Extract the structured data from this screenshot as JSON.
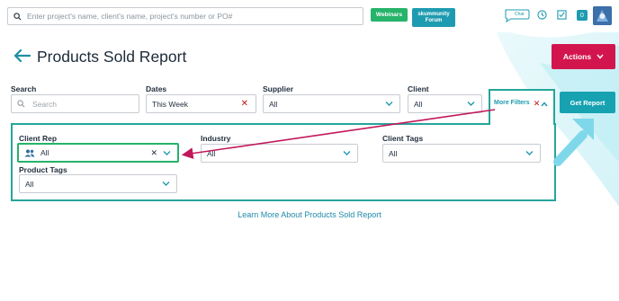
{
  "topbar": {
    "search_placeholder": "Enter project's name, client's name, project's number or PO#",
    "webinars_label": "Webinars",
    "forum_line1": "skummunity",
    "forum_line2": "Forum",
    "chat_label": "Chat",
    "notifications_count": "0"
  },
  "header": {
    "title": "Products Sold Report",
    "actions_label": "Actions"
  },
  "filters": {
    "search": {
      "label": "Search",
      "placeholder": "Search"
    },
    "dates": {
      "label": "Dates",
      "value": "This Week"
    },
    "supplier": {
      "label": "Supplier",
      "value": "All"
    },
    "client": {
      "label": "Client",
      "value": "All"
    },
    "more_filters_label": "More Filters",
    "get_report_label": "Get Report"
  },
  "more_panel": {
    "client_rep": {
      "label": "Client Rep",
      "value": "All"
    },
    "industry": {
      "label": "Industry",
      "value": "All"
    },
    "client_tags": {
      "label": "Client Tags",
      "value": "All"
    },
    "product_tags": {
      "label": "Product Tags",
      "value": "All"
    }
  },
  "footer": {
    "learn_more": "Learn More About Products Sold Report"
  },
  "colors": {
    "brand_teal": "#1e9bb0",
    "actions_red": "#d3154e",
    "webinars_green": "#26b36a",
    "highlight_green": "#26a59a",
    "annotation_arrow": "#c2185b"
  }
}
